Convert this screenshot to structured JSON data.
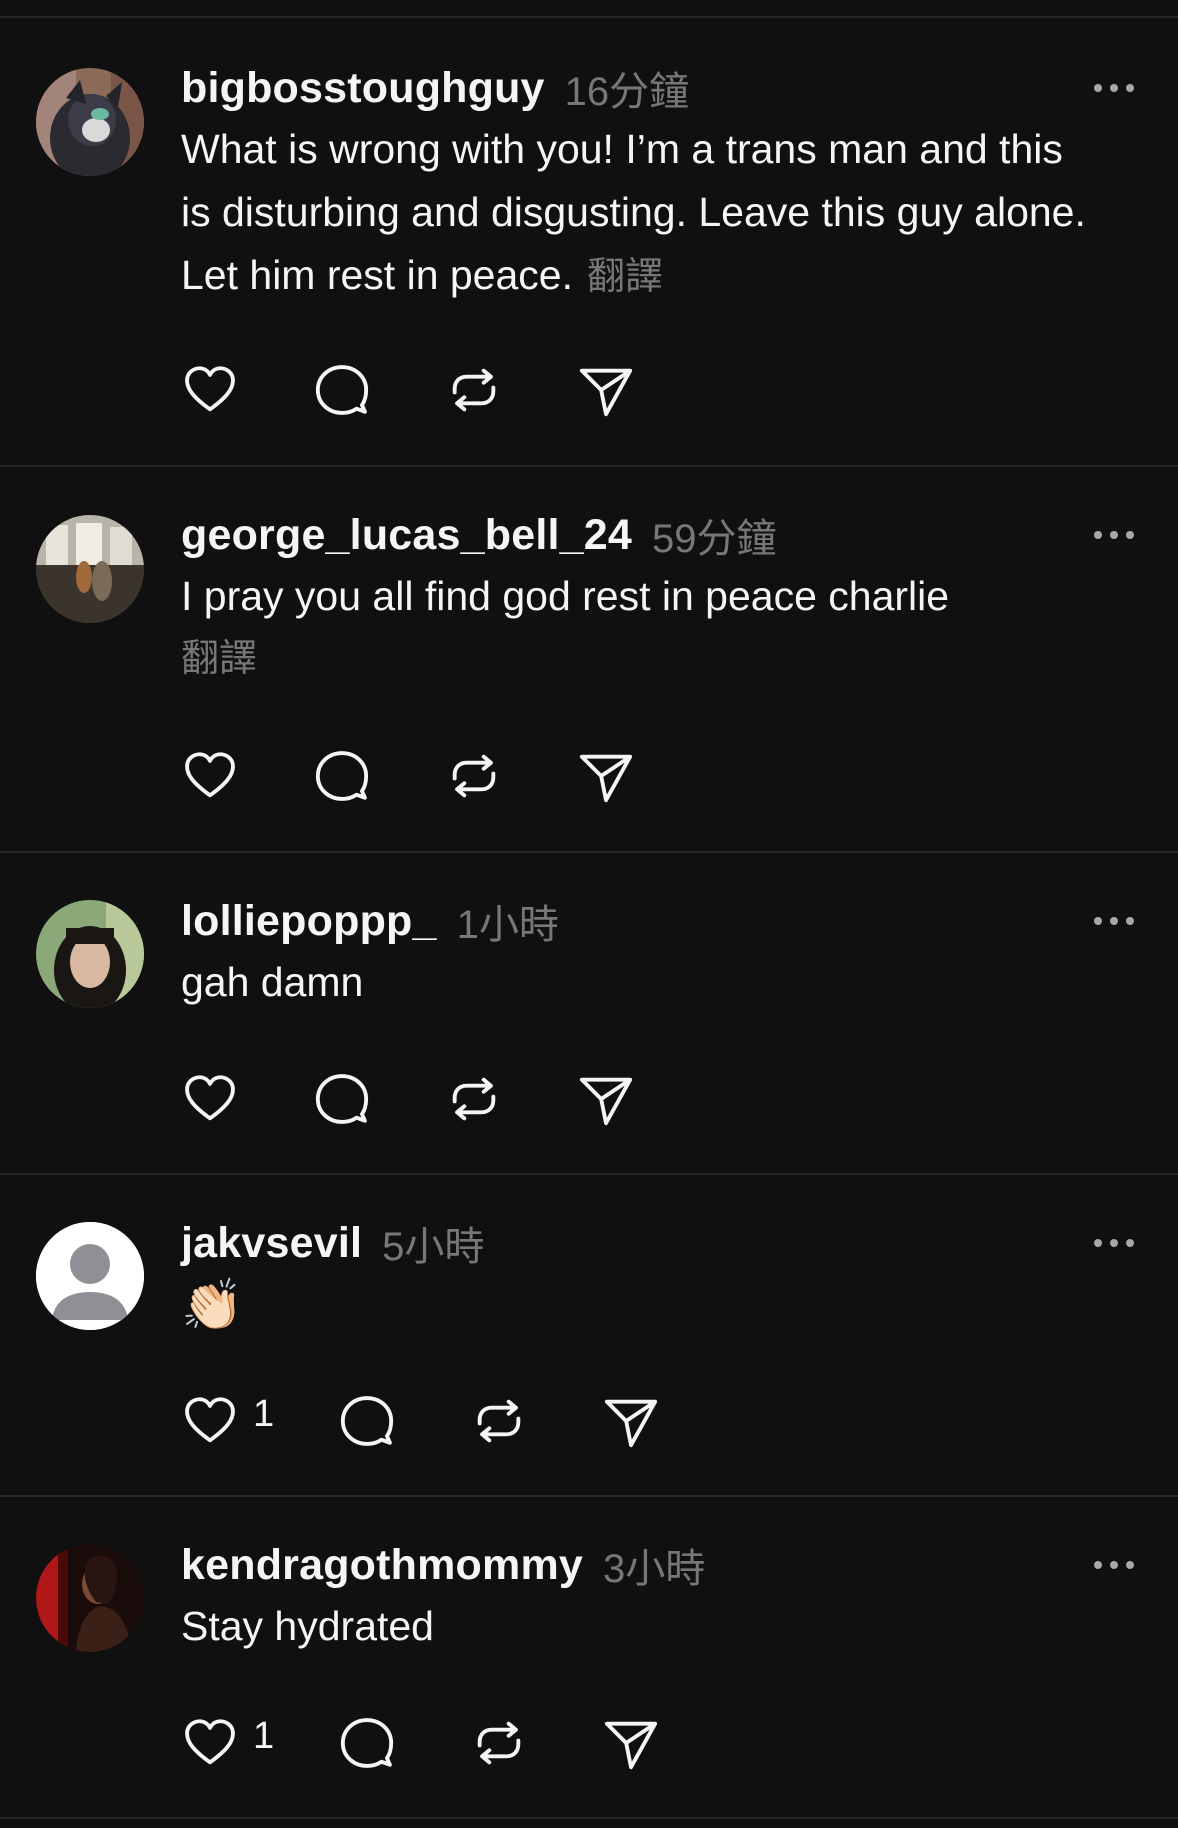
{
  "colors": {
    "background": "#101010",
    "text": "#f3f5f7",
    "muted": "#777777",
    "divider": "#262626"
  },
  "icons": [
    "heart-icon",
    "comment-icon",
    "repost-icon",
    "share-icon",
    "more-icon"
  ],
  "comments": [
    {
      "username": "bigbosstoughguy",
      "time": "16分鐘",
      "text": "What is wrong with you! I’m a trans man and this is disturbing and disgusting. Leave this guy alone. Let him rest in peace.",
      "translate": "翻譯",
      "likes": ""
    },
    {
      "username": "george_lucas_bell_24",
      "time": "59分鐘",
      "text": "I pray you all find god rest in peace charlie",
      "translate": "翻譯",
      "likes": ""
    },
    {
      "username": "lolliepoppp_",
      "time": "1小時",
      "text": "gah damn",
      "translate": "",
      "likes": ""
    },
    {
      "username": "jakvsevil",
      "time": "5小時",
      "text": "👏🏻",
      "translate": "",
      "likes": "1"
    },
    {
      "username": "kendragothmommy",
      "time": "3小時",
      "text": "Stay hydrated",
      "translate": "",
      "likes": "1"
    }
  ]
}
